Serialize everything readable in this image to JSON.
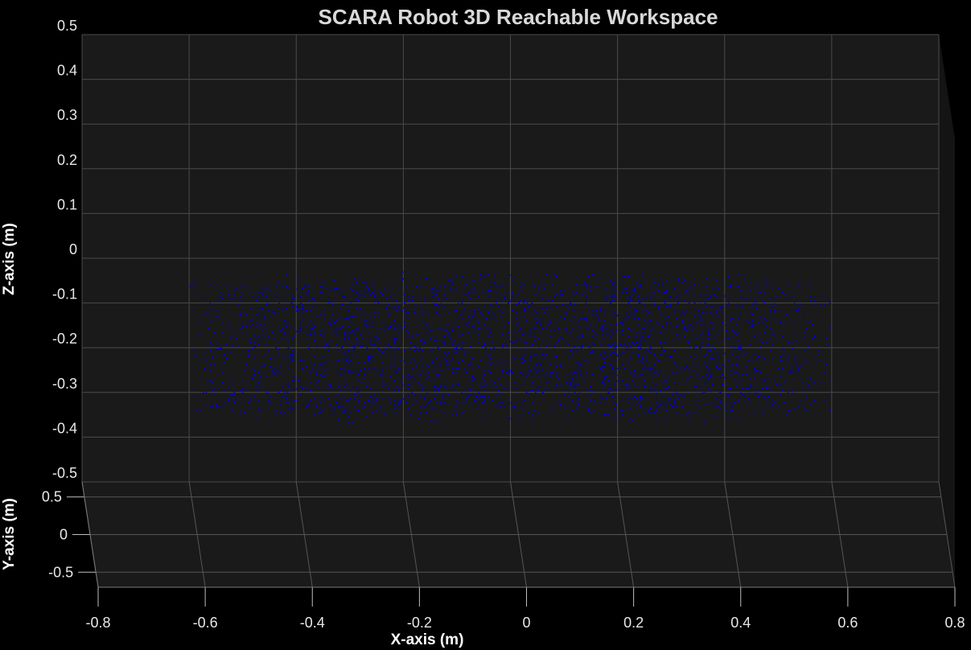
{
  "chart_data": {
    "type": "scatter",
    "title": "SCARA Robot 3D Reachable Workspace",
    "xlabel": "X-axis (m)",
    "ylabel": "Y-axis (m)",
    "zlabel": "Z-axis (m)",
    "xlim": [
      -0.8,
      0.8
    ],
    "ylim": [
      -0.7,
      0.7
    ],
    "zlim": [
      -0.5,
      0.5
    ],
    "x_ticks": [
      "-0.8",
      "-0.6",
      "-0.4",
      "-0.2",
      "0",
      "0.2",
      "0.4",
      "0.6",
      "0.8"
    ],
    "y_ticks": [
      "-0.5",
      "0",
      "0.5"
    ],
    "z_ticks": [
      "-0.5",
      "-0.4",
      "-0.3",
      "-0.2",
      "-0.1",
      "0",
      "0.1",
      "0.2",
      "0.3",
      "0.4",
      "0.5"
    ],
    "grid": true,
    "marker_color": "#0000cc",
    "background_color": "#1a1a1a",
    "series": [
      {
        "description_of_extent": "",
        "workspace": {
          "inner_radius": 0.1,
          "outer_radius": 0.6,
          "z_min": -0.35,
          "z_max": -0.05
        },
        "points": [
          [
            -0.55,
            -0.28,
            -0.12
          ],
          [
            -0.52,
            0.12,
            -0.2
          ],
          [
            -0.5,
            0.25,
            -0.31
          ],
          [
            -0.47,
            -0.35,
            -0.18
          ],
          [
            -0.44,
            0.41,
            -0.26
          ],
          [
            -0.41,
            -0.1,
            -0.33
          ],
          [
            -0.38,
            0.3,
            -0.09
          ],
          [
            -0.35,
            -0.45,
            -0.22
          ],
          [
            -0.32,
            0.48,
            -0.15
          ],
          [
            -0.3,
            -0.2,
            -0.29
          ],
          [
            -0.27,
            0.38,
            -0.07
          ],
          [
            -0.24,
            -0.5,
            -0.24
          ],
          [
            -0.21,
            0.52,
            -0.34
          ],
          [
            -0.18,
            -0.36,
            -0.11
          ],
          [
            -0.15,
            0.28,
            -0.19
          ],
          [
            -0.12,
            -0.55,
            -0.27
          ],
          [
            -0.09,
            0.56,
            -0.06
          ],
          [
            -0.06,
            -0.42,
            -0.3
          ],
          [
            -0.03,
            0.33,
            -0.14
          ],
          [
            0.0,
            -0.58,
            -0.23
          ],
          [
            0.03,
            0.57,
            -0.32
          ],
          [
            0.06,
            -0.3,
            -0.1
          ],
          [
            0.09,
            0.45,
            -0.2
          ],
          [
            0.12,
            -0.53,
            -0.28
          ],
          [
            0.15,
            0.5,
            -0.08
          ],
          [
            0.18,
            -0.4,
            -0.25
          ],
          [
            0.21,
            0.35,
            -0.16
          ],
          [
            0.24,
            -0.48,
            -0.33
          ],
          [
            0.27,
            0.44,
            -0.12
          ],
          [
            0.3,
            -0.25,
            -0.21
          ],
          [
            0.33,
            0.4,
            -0.29
          ],
          [
            0.36,
            -0.38,
            -0.07
          ],
          [
            0.39,
            0.3,
            -0.18
          ],
          [
            0.42,
            -0.32,
            -0.26
          ],
          [
            0.45,
            0.22,
            -0.13
          ],
          [
            0.48,
            -0.2,
            -0.31
          ],
          [
            0.51,
            0.15,
            -0.22
          ],
          [
            0.54,
            -0.1,
            -0.1
          ],
          [
            0.56,
            0.05,
            -0.27
          ],
          [
            -0.56,
            0.04,
            -0.24
          ]
        ]
      }
    ]
  }
}
